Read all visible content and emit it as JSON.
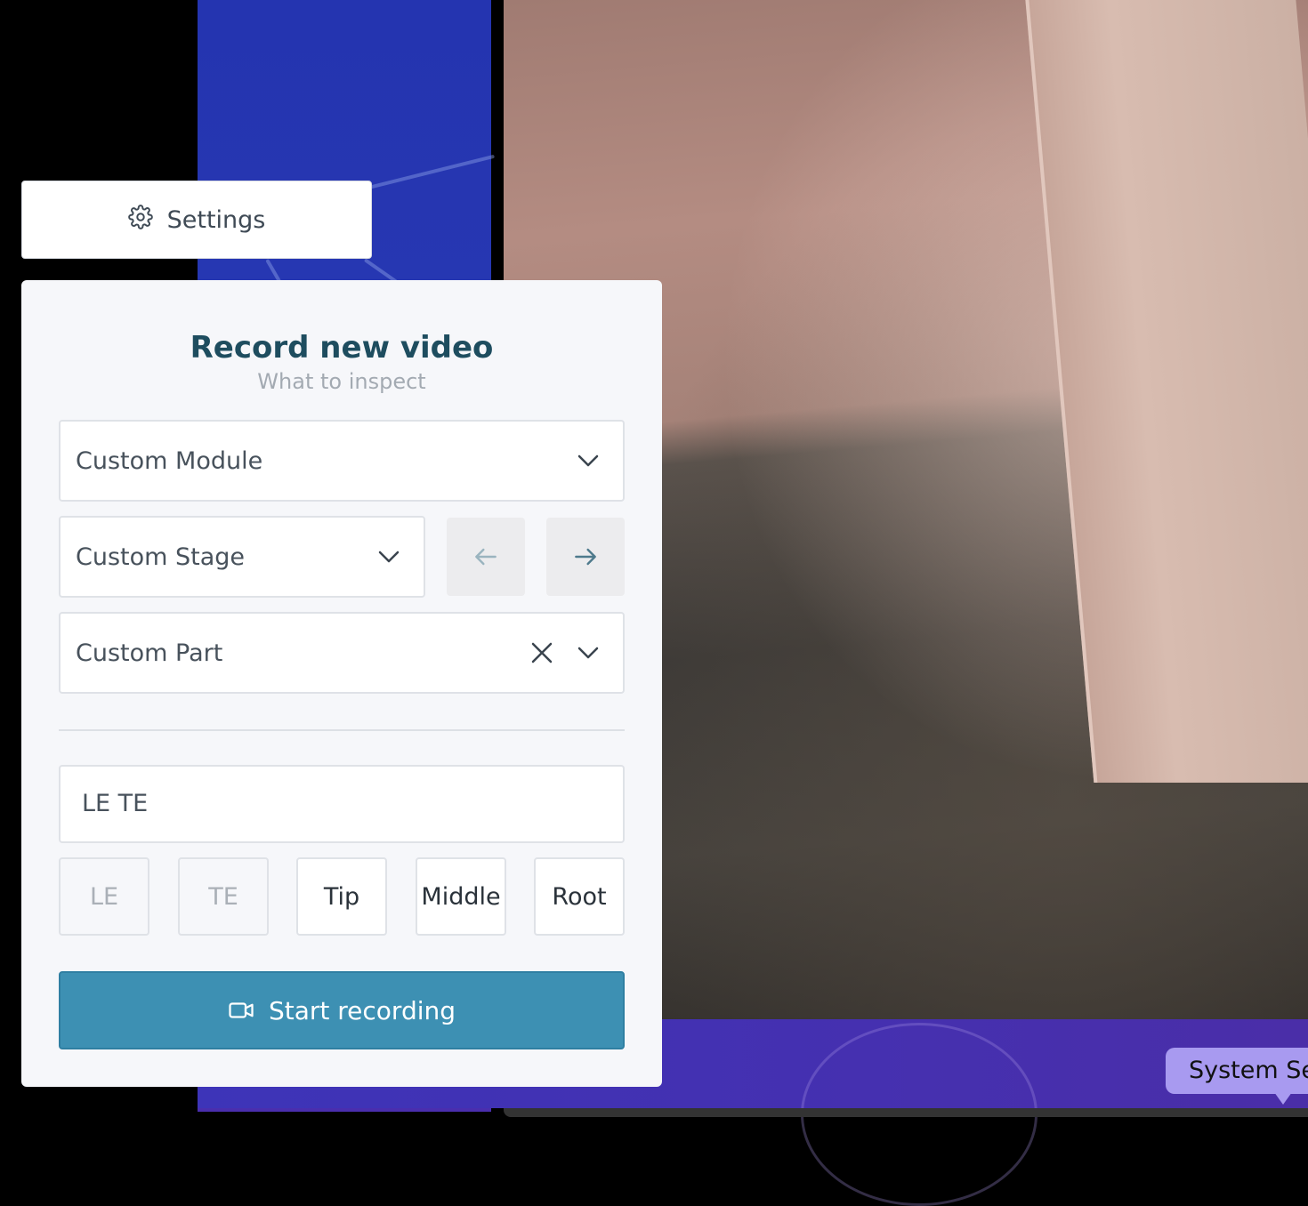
{
  "settings": {
    "label": "Settings",
    "icon": "gear-icon"
  },
  "panel": {
    "title": "Record new video",
    "subtitle": "What to inspect",
    "module_select": {
      "value": "Custom Module",
      "icon": "chevron-down-icon"
    },
    "stage_select": {
      "value": "Custom Stage",
      "icon": "chevron-down-icon"
    },
    "prev_icon": "arrow-left-icon",
    "next_icon": "arrow-right-icon",
    "part_select": {
      "value": "Custom Part",
      "clear_icon": "close-icon",
      "icon": "chevron-down-icon"
    },
    "tags_input": {
      "value": "LE TE"
    },
    "chips": [
      {
        "label": "LE",
        "selected": true
      },
      {
        "label": "TE",
        "selected": true
      },
      {
        "label": "Tip",
        "selected": false
      },
      {
        "label": "Middle",
        "selected": false
      },
      {
        "label": "Root",
        "selected": false
      }
    ],
    "start_button": {
      "label": "Start recording",
      "icon": "video-camera-icon"
    }
  },
  "tooltip": {
    "text": "System Se"
  },
  "colors": {
    "title": "#1e4d5f",
    "accent": "#3d90b3",
    "background_blue": "#2434b0",
    "tooltip": "#a89af0"
  }
}
